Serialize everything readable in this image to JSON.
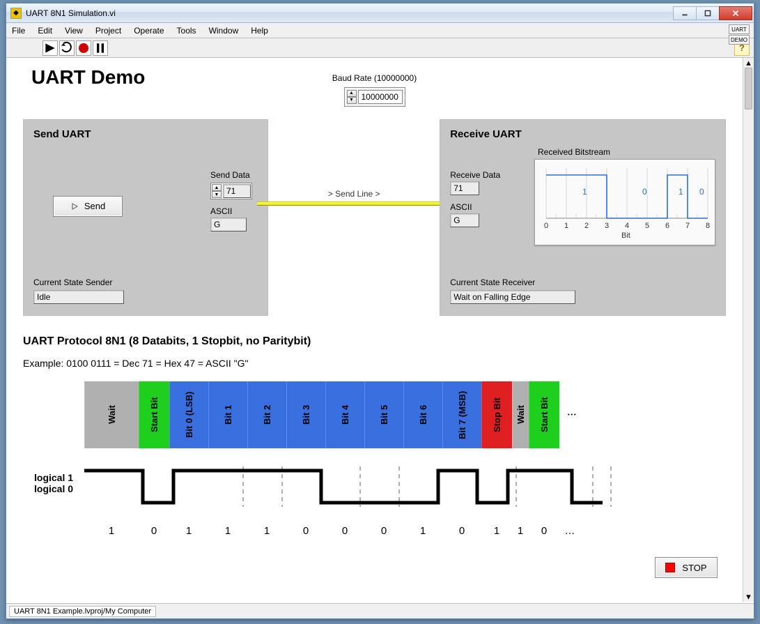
{
  "window": {
    "title": "UART 8N1 Simulation.vi",
    "corner": [
      "UART",
      "DEMO"
    ]
  },
  "menubar": [
    "File",
    "Edit",
    "View",
    "Project",
    "Operate",
    "Tools",
    "Window",
    "Help"
  ],
  "page_title": "UART Demo",
  "baud": {
    "label": "Baud Rate (10000000)",
    "value": "10000000"
  },
  "send": {
    "title": "Send UART",
    "button": "Send",
    "data_label": "Send Data",
    "data_value": "71",
    "ascii_label": "ASCII",
    "ascii_value": "G",
    "state_label": "Current State Sender",
    "state_value": "Idle"
  },
  "connector": {
    "label": "> Send Line >"
  },
  "recv": {
    "title": "Receive UART",
    "data_label": "Receive Data",
    "data_value": "71",
    "ascii_label": "ASCII",
    "ascii_value": "G",
    "bitstream_label": "Received Bitstream",
    "bitstream_xlabel": "Bit",
    "state_label": "Current State Receiver",
    "state_value": "Wait on Falling Edge"
  },
  "protocol": {
    "title": "UART Protocol 8N1 (8 Databits, 1 Stopbit, no Paritybit)",
    "example": "Example: 0100 0111 = Dec 71 = Hex 47 = ASCII \"G\"",
    "blocks": [
      "Wait",
      "Start Bit",
      "Bit 0 (LSB)",
      "Bit 1",
      "Bit 2",
      "Bit 3",
      "Bit 4",
      "Bit 5",
      "Bit 6",
      "Bit 7 (MSB)",
      "Stop Bit",
      "Wait",
      "Start Bit"
    ],
    "logical1": "logical 1",
    "logical0": "logical 0",
    "bitvals": [
      "1",
      "0",
      "1",
      "1",
      "1",
      "0",
      "0",
      "0",
      "1",
      "0",
      "1",
      "1",
      "0",
      "…"
    ]
  },
  "stop_label": "STOP",
  "status_path": "UART 8N1 Example.lvproj/My Computer",
  "chart_data": {
    "type": "line",
    "title": "Received Bitstream",
    "xlabel": "Bit",
    "ylabel": "",
    "x": [
      0,
      1,
      2,
      3,
      4,
      5,
      6,
      7,
      8
    ],
    "series": [
      {
        "name": "bitstream",
        "values_step": [
          1,
          1,
          1,
          1,
          0,
          0,
          0,
          1,
          0
        ]
      }
    ],
    "annotations": [
      {
        "x": 3,
        "y": 1,
        "text": "1"
      },
      {
        "x": 5,
        "y": 0,
        "text": "0"
      },
      {
        "x": 7,
        "y": 1,
        "text": "1"
      },
      {
        "x": 8,
        "y": 0,
        "text": "0"
      }
    ],
    "ylim": [
      0,
      1
    ],
    "xlim": [
      0,
      8
    ]
  }
}
